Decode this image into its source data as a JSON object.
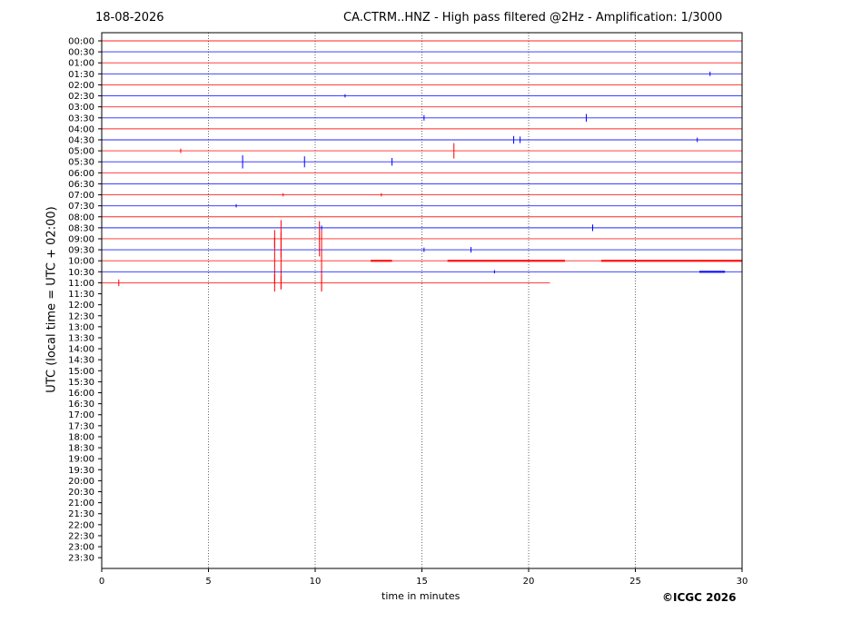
{
  "header": {
    "date": "18-08-2026",
    "title": "CA.CTRM..HNZ - High pass filtered @2Hz - Amplification: 1/3000"
  },
  "footer": {
    "copyright": "©ICGC 2026"
  },
  "chart_data": {
    "type": "line",
    "title": "CA.CTRM..HNZ - High pass filtered @2Hz - Amplification: 1/3000",
    "xlabel": "time in minutes",
    "ylabel": "UTC (local time = UTC + 02:00)",
    "xlim": [
      0,
      30
    ],
    "xticks": [
      0,
      5,
      10,
      15,
      20,
      25,
      30
    ],
    "vertical_gridlines_dotted": [
      5,
      10,
      15,
      20,
      25
    ],
    "rows": [
      "00:00",
      "00:30",
      "01:00",
      "01:30",
      "02:00",
      "02:30",
      "03:00",
      "03:30",
      "04:00",
      "04:30",
      "05:00",
      "05:30",
      "06:00",
      "06:30",
      "07:00",
      "07:30",
      "08:00",
      "08:30",
      "09:00",
      "09:30",
      "10:00",
      "10:30",
      "11:00",
      "11:30",
      "12:00",
      "12:30",
      "13:00",
      "13:30",
      "14:00",
      "14:30",
      "15:00",
      "15:30",
      "16:00",
      "16:30",
      "17:00",
      "17:30",
      "18:00",
      "18:30",
      "19:00",
      "19:30",
      "20:00",
      "20:30",
      "21:00",
      "21:30",
      "22:00",
      "22:30",
      "23:00",
      "23:30"
    ],
    "series_colors": [
      "#ff0000",
      "#0000ff"
    ],
    "traces": [
      {
        "row": "00:00",
        "end": 30
      },
      {
        "row": "00:30",
        "end": 30
      },
      {
        "row": "01:00",
        "end": 30
      },
      {
        "row": "01:30",
        "end": 30,
        "events": [
          {
            "t": 28.5,
            "amp": 0.2
          }
        ]
      },
      {
        "row": "02:00",
        "end": 30
      },
      {
        "row": "02:30",
        "end": 30,
        "events": [
          {
            "t": 11.4,
            "amp": 0.15
          }
        ]
      },
      {
        "row": "03:00",
        "end": 30
      },
      {
        "row": "03:30",
        "end": 30,
        "events": [
          {
            "t": 15.1,
            "amp": 0.25
          },
          {
            "t": 22.7,
            "amp": 0.35
          }
        ]
      },
      {
        "row": "04:00",
        "end": 30
      },
      {
        "row": "04:30",
        "end": 30,
        "events": [
          {
            "t": 19.3,
            "amp": 0.35
          },
          {
            "t": 19.6,
            "amp": 0.3
          },
          {
            "t": 27.9,
            "amp": 0.2
          }
        ]
      },
      {
        "row": "05:00",
        "end": 30,
        "events": [
          {
            "t": 3.7,
            "amp": 0.2
          },
          {
            "t": 16.5,
            "amp": 0.7
          }
        ]
      },
      {
        "row": "05:30",
        "end": 30,
        "events": [
          {
            "t": 6.6,
            "amp": 0.6
          },
          {
            "t": 9.5,
            "amp": 0.5
          },
          {
            "t": 13.6,
            "amp": 0.35
          }
        ]
      },
      {
        "row": "06:00",
        "end": 30
      },
      {
        "row": "06:30",
        "end": 30
      },
      {
        "row": "07:00",
        "end": 30,
        "events": [
          {
            "t": 8.5,
            "amp": 0.15
          },
          {
            "t": 13.1,
            "amp": 0.15
          }
        ]
      },
      {
        "row": "07:30",
        "end": 30,
        "events": [
          {
            "t": 6.3,
            "amp": 0.15
          }
        ]
      },
      {
        "row": "08:00",
        "end": 30
      },
      {
        "row": "08:30",
        "end": 30,
        "events": [
          {
            "t": 10.3,
            "amp": 0.2
          },
          {
            "t": 23.0,
            "amp": 0.3
          }
        ]
      },
      {
        "row": "09:00",
        "end": 30,
        "events": [
          {
            "t": 8.1,
            "amp": 0.8
          },
          {
            "t": 8.4,
            "amp": 1.7
          },
          {
            "t": 10.2,
            "amp": 1.6
          }
        ]
      },
      {
        "row": "09:30",
        "end": 30,
        "events": [
          {
            "t": 15.1,
            "amp": 0.2
          },
          {
            "t": 17.3,
            "amp": 0.25
          }
        ]
      },
      {
        "row": "10:00",
        "end": 30,
        "events": [
          {
            "t": 8.1,
            "amp": 2.1
          },
          {
            "t": 8.4,
            "amp": 2.6
          },
          {
            "t": 10.3,
            "amp": 2.8
          }
        ],
        "bursts": [
          {
            "from": 12.6,
            "to": 13.6
          },
          {
            "from": 16.2,
            "to": 21.7
          },
          {
            "from": 23.4,
            "to": 30
          }
        ]
      },
      {
        "row": "10:30",
        "end": 30,
        "events": [
          {
            "t": 18.4,
            "amp": 0.15
          }
        ],
        "bursts": [
          {
            "from": 28.0,
            "to": 29.2
          }
        ]
      },
      {
        "row": "11:00",
        "end": 21,
        "events": [
          {
            "t": 0.8,
            "amp": 0.3
          },
          {
            "t": 8.1,
            "amp": 0.8
          },
          {
            "t": 8.4,
            "amp": 0.6
          },
          {
            "t": 10.3,
            "amp": 0.7
          }
        ]
      }
    ]
  }
}
